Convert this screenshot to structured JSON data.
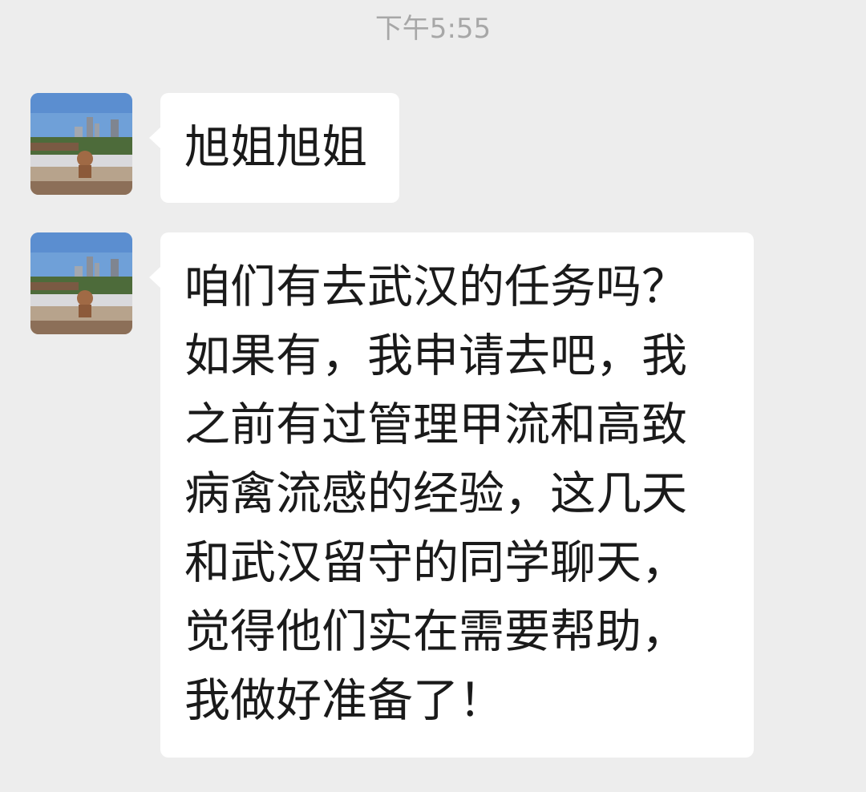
{
  "timestamp": "下午5:55",
  "messages": [
    {
      "sender_avatar": "city-rooftop-avatar",
      "lines": [
        "旭姐旭姐"
      ]
    },
    {
      "sender_avatar": "city-rooftop-avatar",
      "lines": [
        "咱们有去武汉的任务吗？",
        "如果有，我申请去吧，我",
        "之前有过管理甲流和高致",
        "病禽流感的经验，这几天",
        "和武汉留守的同学聊天，",
        "觉得他们实在需要帮助，",
        "我做好准备了！"
      ]
    }
  ],
  "colors": {
    "background": "#ededed",
    "bubble": "#ffffff",
    "timestamp_text": "#a7a7a7",
    "message_text": "#1a1a1a"
  }
}
